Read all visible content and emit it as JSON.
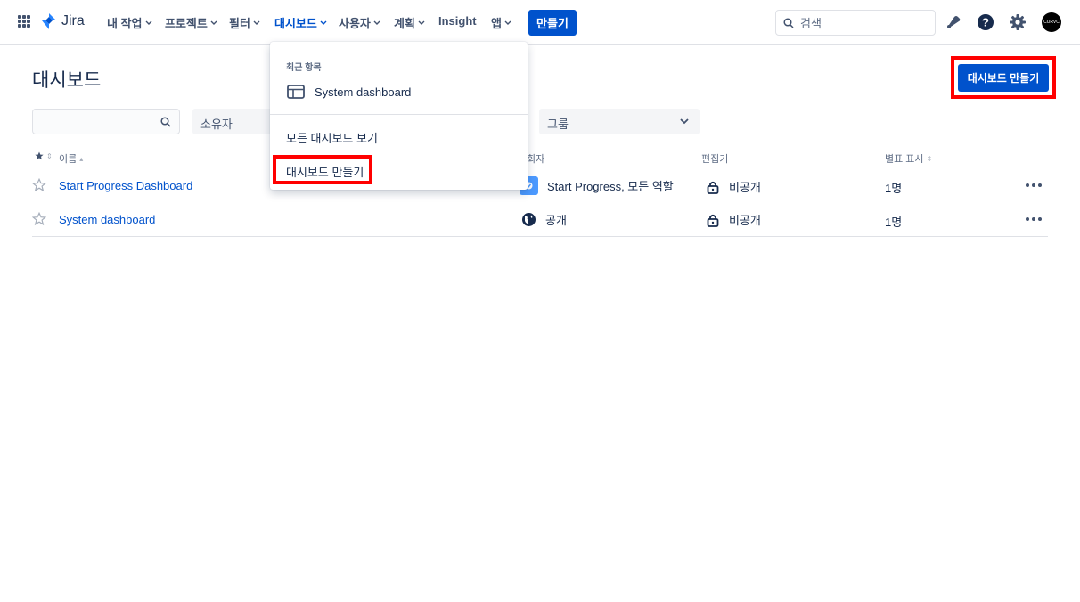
{
  "nav": {
    "logo_text": "Jira",
    "items": [
      {
        "label": "내 작업"
      },
      {
        "label": "프로젝트"
      },
      {
        "label": "필터"
      },
      {
        "label": "대시보드"
      },
      {
        "label": "사용자"
      },
      {
        "label": "계획"
      },
      {
        "label": "Insight"
      },
      {
        "label": "앱"
      }
    ],
    "create_label": "만들기",
    "search_placeholder": "검색",
    "avatar_text": "CURVC"
  },
  "page": {
    "title": "대시보드",
    "create_dashboard_label": "대시보드 만들기"
  },
  "filters": {
    "search_value": "",
    "owner_label": "소유자",
    "group_label": "그룹"
  },
  "table": {
    "headers": {
      "name": "이름",
      "shared_with": "회자",
      "editors": "편집기",
      "starred": "별표 표시"
    },
    "rows": [
      {
        "name": "Start Progress Dashboard",
        "shared_with": "Start Progress, 모든 역할",
        "editors": "비공개",
        "starred": "1명"
      },
      {
        "name": "System dashboard",
        "shared_with": "공개",
        "editors": "비공개",
        "starred": "1명"
      }
    ]
  },
  "dropdown": {
    "heading": "최근 항목",
    "recent_item": "System dashboard",
    "view_all": "모든 대시보드 보기",
    "create": "대시보드 만들기"
  },
  "colors": {
    "brand": "#0052CC",
    "highlight": "#FF0000"
  }
}
